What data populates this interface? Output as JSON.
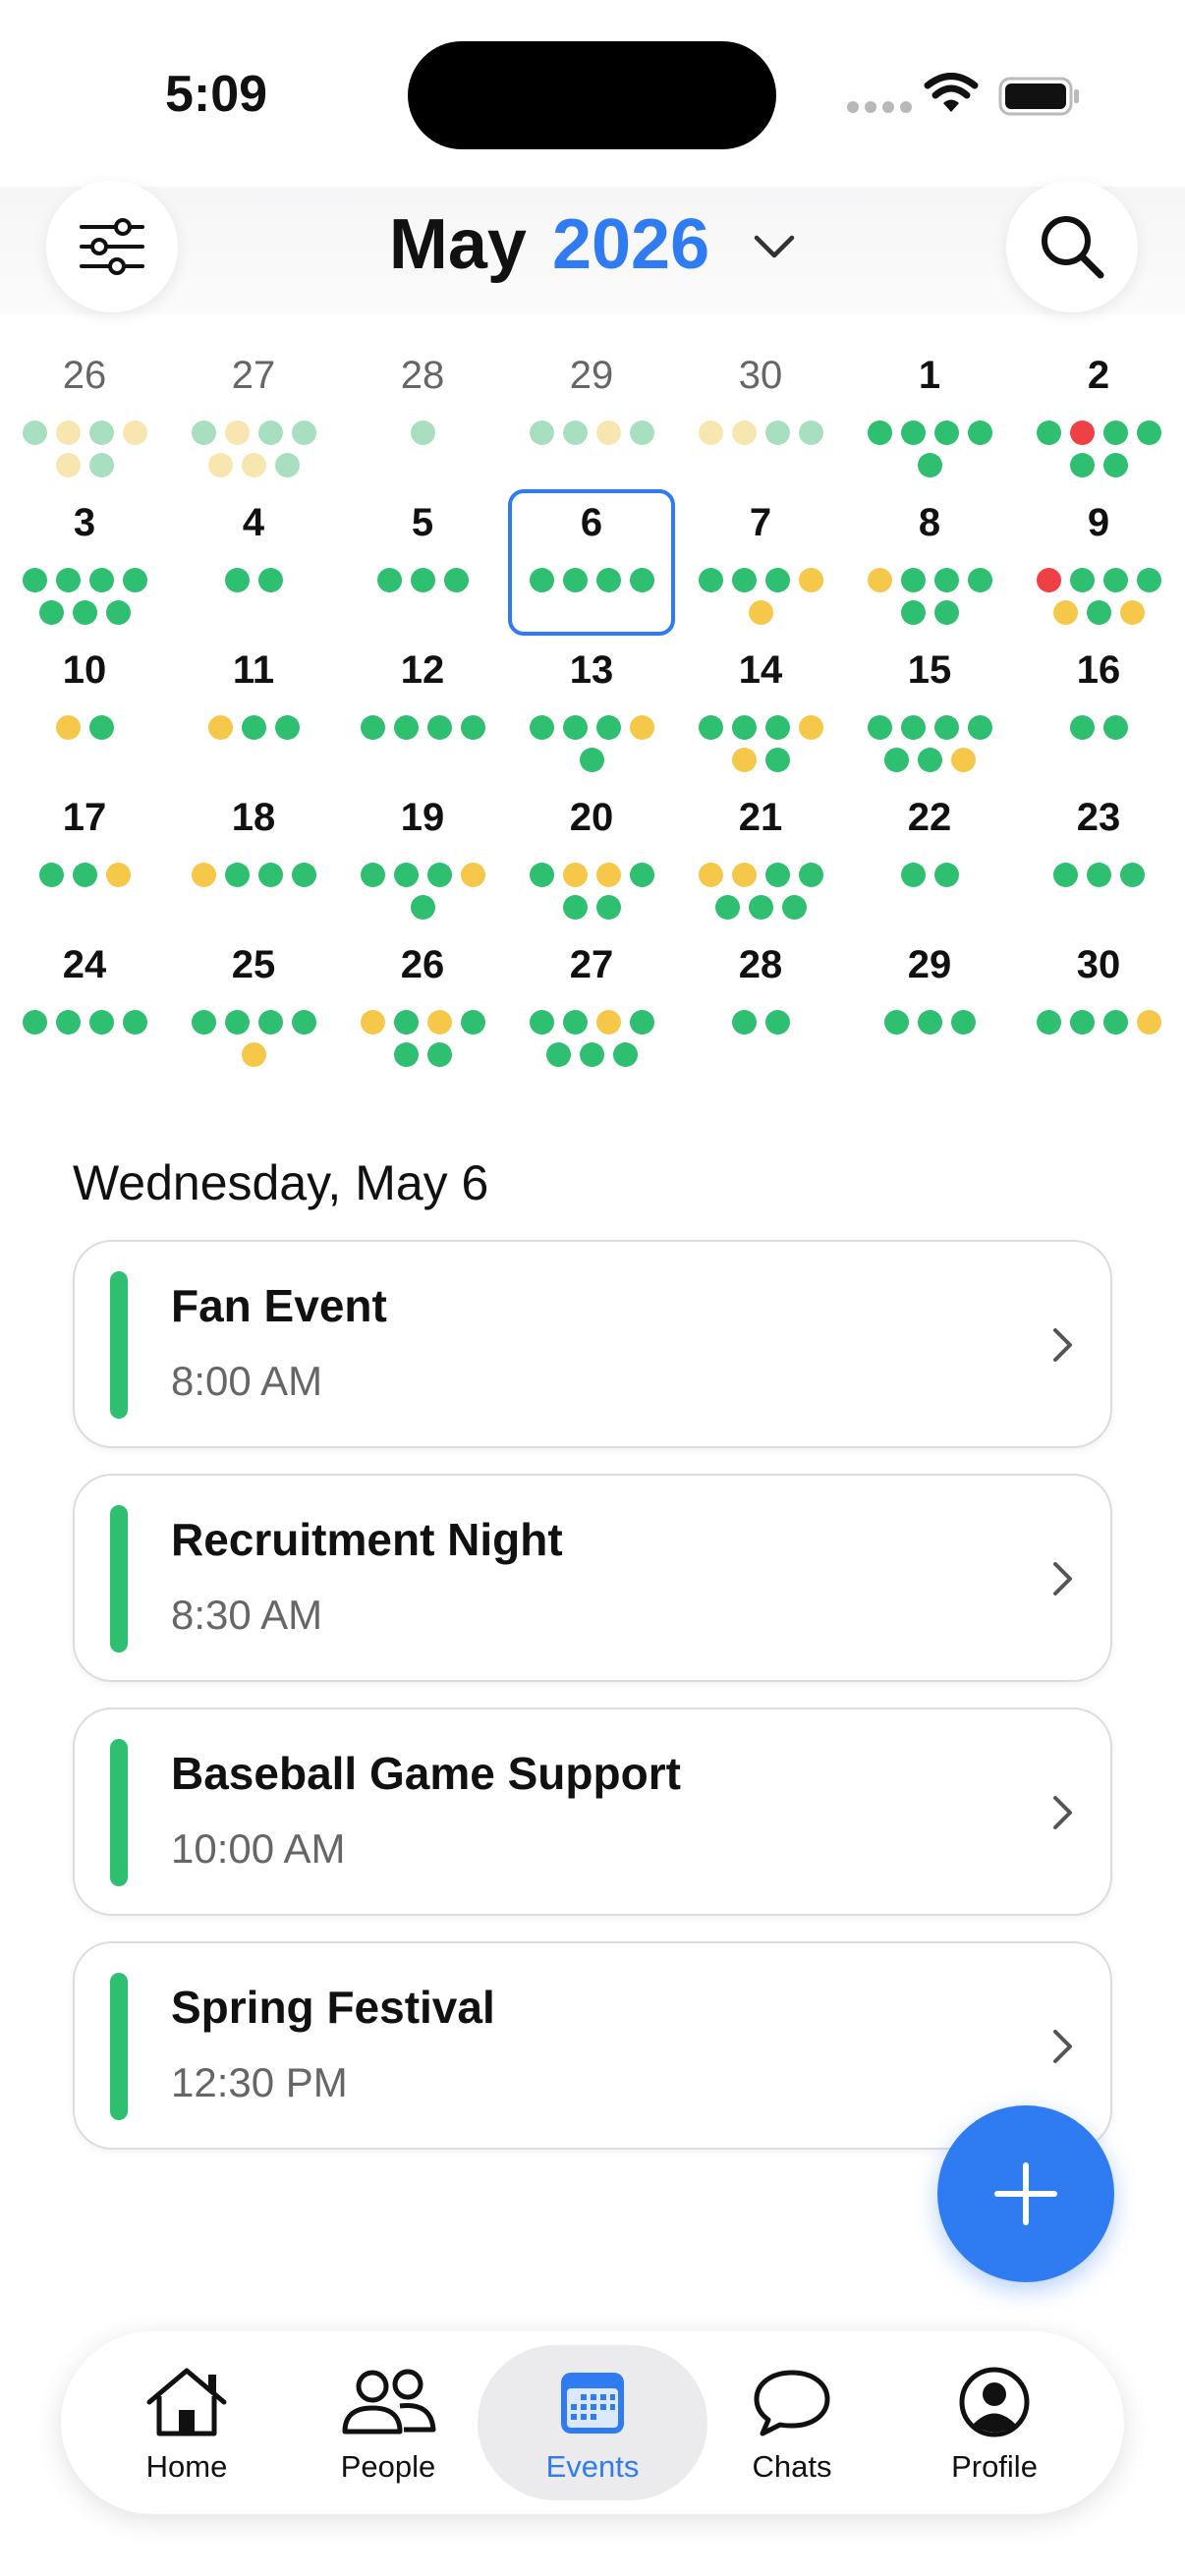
{
  "status_bar": {
    "time": "5:09"
  },
  "header": {
    "month": "May",
    "year": "2026"
  },
  "colors": {
    "accent": "#2f7cf2",
    "green": "#2fbf71",
    "yellow": "#f5c84a",
    "red": "#ef4046",
    "faded_green": "#a8dfc1",
    "faded_yellow": "#f8e6b0"
  },
  "calendar": {
    "weeks": [
      [
        {
          "day": "26",
          "other": true,
          "dots": [
            "g",
            "y",
            "g",
            "y",
            "y",
            "g"
          ]
        },
        {
          "day": "27",
          "other": true,
          "dots": [
            "g",
            "y",
            "g",
            "g",
            "y",
            "y",
            "g"
          ]
        },
        {
          "day": "28",
          "other": true,
          "dots": [
            "g"
          ]
        },
        {
          "day": "29",
          "other": true,
          "dots": [
            "g",
            "g",
            "y",
            "g"
          ]
        },
        {
          "day": "30",
          "other": true,
          "dots": [
            "y",
            "y",
            "g",
            "g"
          ]
        },
        {
          "day": "1",
          "other": false,
          "dots": [
            "g",
            "g",
            "g",
            "g",
            "g"
          ]
        },
        {
          "day": "2",
          "other": false,
          "dots": [
            "g",
            "r",
            "g",
            "g",
            "g",
            "g"
          ]
        }
      ],
      [
        {
          "day": "3",
          "other": false,
          "dots": [
            "g",
            "g",
            "g",
            "g",
            "g",
            "g",
            "g"
          ]
        },
        {
          "day": "4",
          "other": false,
          "dots": [
            "g",
            "g"
          ]
        },
        {
          "day": "5",
          "other": false,
          "dots": [
            "g",
            "g",
            "g"
          ]
        },
        {
          "day": "6",
          "other": false,
          "selected": true,
          "dots": [
            "g",
            "g",
            "g",
            "g"
          ]
        },
        {
          "day": "7",
          "other": false,
          "dots": [
            "g",
            "g",
            "g",
            "y",
            "y"
          ]
        },
        {
          "day": "8",
          "other": false,
          "dots": [
            "y",
            "g",
            "g",
            "g",
            "g",
            "g"
          ]
        },
        {
          "day": "9",
          "other": false,
          "dots": [
            "r",
            "g",
            "g",
            "g",
            "y",
            "g",
            "y"
          ]
        }
      ],
      [
        {
          "day": "10",
          "other": false,
          "dots": [
            "y",
            "g"
          ]
        },
        {
          "day": "11",
          "other": false,
          "dots": [
            "y",
            "g",
            "g"
          ]
        },
        {
          "day": "12",
          "other": false,
          "dots": [
            "g",
            "g",
            "g",
            "g"
          ]
        },
        {
          "day": "13",
          "other": false,
          "dots": [
            "g",
            "g",
            "g",
            "y",
            "g"
          ]
        },
        {
          "day": "14",
          "other": false,
          "dots": [
            "g",
            "g",
            "g",
            "y",
            "y",
            "g"
          ]
        },
        {
          "day": "15",
          "other": false,
          "dots": [
            "g",
            "g",
            "g",
            "g",
            "g",
            "g",
            "y"
          ]
        },
        {
          "day": "16",
          "other": false,
          "dots": [
            "g",
            "g"
          ]
        }
      ],
      [
        {
          "day": "17",
          "other": false,
          "dots": [
            "g",
            "g",
            "y"
          ]
        },
        {
          "day": "18",
          "other": false,
          "dots": [
            "y",
            "g",
            "g",
            "g"
          ]
        },
        {
          "day": "19",
          "other": false,
          "dots": [
            "g",
            "g",
            "g",
            "y",
            "g"
          ]
        },
        {
          "day": "20",
          "other": false,
          "dots": [
            "g",
            "y",
            "y",
            "g",
            "g",
            "g"
          ]
        },
        {
          "day": "21",
          "other": false,
          "dots": [
            "y",
            "y",
            "g",
            "g",
            "g",
            "g",
            "g"
          ]
        },
        {
          "day": "22",
          "other": false,
          "dots": [
            "g",
            "g"
          ]
        },
        {
          "day": "23",
          "other": false,
          "dots": [
            "g",
            "g",
            "g"
          ]
        }
      ],
      [
        {
          "day": "24",
          "other": false,
          "dots": [
            "g",
            "g",
            "g",
            "g"
          ]
        },
        {
          "day": "25",
          "other": false,
          "dots": [
            "g",
            "g",
            "g",
            "g",
            "y"
          ]
        },
        {
          "day": "26",
          "other": false,
          "dots": [
            "y",
            "g",
            "y",
            "g",
            "g",
            "g"
          ]
        },
        {
          "day": "27",
          "other": false,
          "dots": [
            "g",
            "g",
            "y",
            "g",
            "g",
            "g",
            "g"
          ]
        },
        {
          "day": "28",
          "other": false,
          "dots": [
            "g",
            "g"
          ]
        },
        {
          "day": "29",
          "other": false,
          "dots": [
            "g",
            "g",
            "g"
          ]
        },
        {
          "day": "30",
          "other": false,
          "dots": [
            "g",
            "g",
            "g",
            "y"
          ]
        }
      ]
    ]
  },
  "selected_date_heading": "Wednesday, May 6",
  "events": [
    {
      "title": "Fan Event",
      "time": "8:00 AM"
    },
    {
      "title": "Recruitment Night",
      "time": "8:30 AM"
    },
    {
      "title": "Baseball Game Support",
      "time": "10:00 AM"
    },
    {
      "title": "Spring Festival",
      "time": "12:30 PM"
    }
  ],
  "tabs": [
    {
      "label": "Home",
      "icon": "house-icon"
    },
    {
      "label": "People",
      "icon": "people-icon"
    },
    {
      "label": "Events",
      "icon": "calendar-icon",
      "active": true
    },
    {
      "label": "Chats",
      "icon": "chat-bubble-icon"
    },
    {
      "label": "Profile",
      "icon": "profile-icon"
    }
  ]
}
